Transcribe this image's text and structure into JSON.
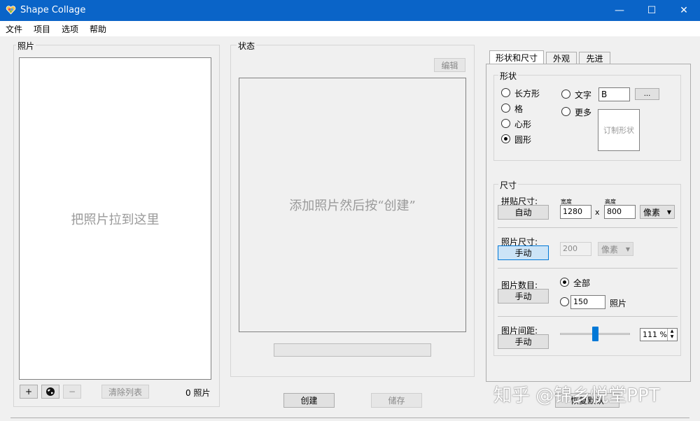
{
  "window": {
    "title": "Shape Collage",
    "minimize": "—",
    "maximize": "☐",
    "close": "✕"
  },
  "menu": [
    "文件",
    "项目",
    "选项",
    "帮助"
  ],
  "photos": {
    "title": "照片",
    "drop_hint": "把照片拉到这里",
    "add_label": "+",
    "remove_label": "−",
    "clear_label": "清除列表",
    "count": "0 照片"
  },
  "status": {
    "title": "状态",
    "edit_label": "编辑",
    "preview_hint": "添加照片然后按“创建”"
  },
  "actions": {
    "create": "创建",
    "save": "储存",
    "reset": "恢复默认"
  },
  "tabs": [
    "形状和尺寸",
    "外观",
    "先进"
  ],
  "shape": {
    "title": "形状",
    "options": [
      "长方形",
      "格",
      "心形",
      "圆形"
    ],
    "selected": "圆形",
    "text_label": "文字",
    "text_value": "B",
    "more_label": "更多",
    "browse_label": "...",
    "custom_label": "订制形状"
  },
  "size": {
    "title": "尺寸",
    "collage_label": "拼贴尺寸:",
    "collage_mode": "自动",
    "width_caption": "宽度",
    "height_caption": "高度",
    "width": "1280",
    "times": "x",
    "height": "800",
    "unit": "像素",
    "photo_label": "照片尺寸:",
    "photo_mode": "手动",
    "photo_value": "200",
    "photo_unit": "像素",
    "count_label": "图片数目:",
    "count_mode": "手动",
    "all_label": "全部",
    "count_value": "150",
    "count_unit": "照片",
    "spacing_label": "图片间距:",
    "spacing_mode": "手动",
    "spacing_value": "111 %",
    "spacing_level": 0.5
  },
  "watermark": "知乎 @锦乡悦堂PPT"
}
